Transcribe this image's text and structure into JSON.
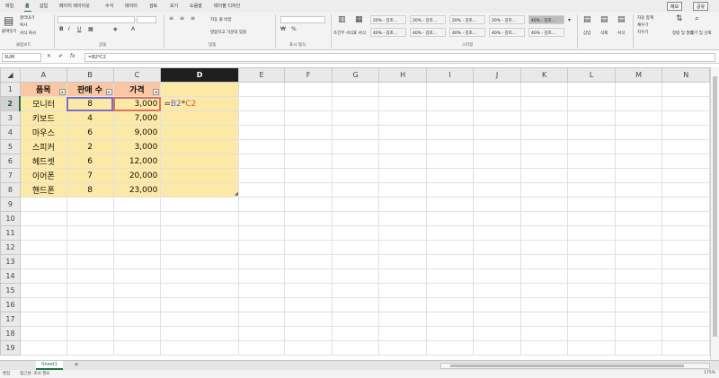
{
  "menu": {
    "tabs": [
      "파일",
      "홈",
      "삽입",
      "페이지 레이아웃",
      "수식",
      "데이터",
      "검토",
      "보기",
      "도움말",
      "테이블 디자인"
    ],
    "active_tab": "홈",
    "share_label": "메모",
    "share2_label": "공유"
  },
  "ribbon": {
    "clipboard": {
      "paste": "붙여넣기",
      "cut": "잘라내기",
      "copy": "복사",
      "format_painter": "서식 복사",
      "label": "클립보드"
    },
    "font": {
      "label": "글꼴"
    },
    "align": {
      "wrap": "자동 줄 바꿈",
      "merge": "병합하고 가운데 맞춤",
      "label": "맞춤"
    },
    "number": {
      "label": "표시 형식"
    },
    "conditional": {
      "cond": "조건부 서식",
      "table": "표 서식",
      "label": ""
    },
    "styles": {
      "cells": [
        "20% - 강조...",
        "20% - 강조...",
        "20% - 강조...",
        "20% - 강조...",
        "20% - 강조...",
        "40% - 강조...",
        "40% - 강조...",
        "40% - 강조...",
        "40% - 강조...",
        "40% - 강조...",
        "40% - 강조...",
        "40% - 강조..."
      ],
      "label": "스타일"
    },
    "cells_grp": {
      "insert": "삽입",
      "delete": "삭제",
      "format": "서식"
    },
    "editing": {
      "autosum": "자동 합계",
      "fill": "채우기",
      "clear": "지우기",
      "sort": "정렬 및 필터",
      "find": "찾기 및 선택"
    }
  },
  "formula_bar": {
    "name_box": "SUM",
    "cancel": "✕",
    "enter": "✔",
    "fx": "fx",
    "formula": "=B2*C2"
  },
  "columns": [
    "A",
    "B",
    "C",
    "D",
    "E",
    "F",
    "G",
    "H",
    "I",
    "J",
    "K",
    "L",
    "M",
    "N"
  ],
  "rows": [
    "1",
    "2",
    "3",
    "4",
    "5",
    "6",
    "7",
    "8",
    "9",
    "10",
    "11",
    "12",
    "13",
    "14",
    "15",
    "16",
    "17",
    "18",
    "19"
  ],
  "table": {
    "headers": [
      "품목",
      "판매 수",
      "가격"
    ],
    "data": [
      [
        "모니터",
        "8",
        "3,000"
      ],
      [
        "키보드",
        "4",
        "7,000"
      ],
      [
        "마우스",
        "6",
        "9,000"
      ],
      [
        "스피커",
        "2",
        "3,000"
      ],
      [
        "헤드셋",
        "6",
        "12,000"
      ],
      [
        "이어폰",
        "7",
        "20,000"
      ],
      [
        "핸드폰",
        "8",
        "23,000"
      ]
    ],
    "editing_cell": {
      "eq": "=",
      "ref1": "B2",
      "op": "*",
      "ref2": "C2"
    }
  },
  "sheet_tab": "Sheet1",
  "add_sheet": "+",
  "status": {
    "mode": "편집",
    "accessibility": "접근성: 조사 필요",
    "zoom": "175%"
  }
}
